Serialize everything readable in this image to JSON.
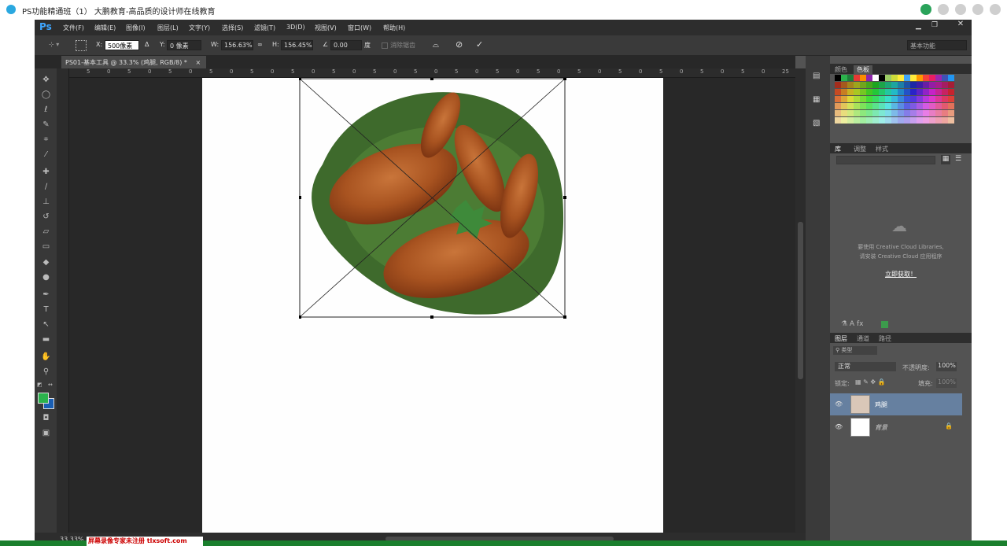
{
  "window": {
    "title": "PS功能精通班（1） 大鹏教育-高品质的设计师在线教育"
  },
  "menu": {
    "items": [
      "文件(F)",
      "编辑(E)",
      "图像(I)",
      "图层(L)",
      "文字(Y)",
      "选择(S)",
      "滤镜(T)",
      "3D(D)",
      "视图(V)",
      "窗口(W)",
      "帮助(H)"
    ]
  },
  "options": {
    "x_label": "X:",
    "x_value": "500像素",
    "y_label": "Y:",
    "y_value": "0 像素",
    "w_label": "W:",
    "w_value": "156.63%",
    "h_label": "H:",
    "h_value": "156.45%",
    "angle_value": "0.00",
    "angle_unit": "度",
    "antialias_label": "消除锯齿",
    "workspace": "基本功能"
  },
  "document": {
    "tab_title": "PS01-基本工具 @ 33.3% (鸡腿, RGB/8) *",
    "zoom": "33.33%"
  },
  "ruler": {
    "top_ticks": [
      "5",
      "0",
      "5",
      "0",
      "5",
      "0",
      "5",
      "0",
      "5",
      "0",
      "5",
      "0",
      "5",
      "0",
      "5",
      "0",
      "5",
      "0",
      "5",
      "0",
      "5",
      "0",
      "5",
      "0",
      "5",
      "0",
      "5",
      "0",
      "5",
      "0",
      "5",
      "0",
      "5",
      "0",
      "25"
    ]
  },
  "panels": {
    "swatch_tabs": [
      "颜色",
      "色板"
    ],
    "library_tabs": [
      "库",
      "调整",
      "样式"
    ],
    "library_msg1": "要使用 Creative Cloud Libraries,",
    "library_msg2": "请安装 Creative Cloud 应用程序",
    "library_link": "立即获取！",
    "layer_tabs": [
      "图层",
      "通道",
      "路径"
    ],
    "filter_kind": "类型",
    "blend_mode": "正常",
    "opacity_label": "不透明度:",
    "opacity_value": "100%",
    "lock_label": "锁定:",
    "fill_label": "填充:",
    "fill_value": "100%",
    "layers": [
      {
        "name": "鸡腿",
        "selected": true
      },
      {
        "name": "背景",
        "selected": false,
        "locked": true
      }
    ]
  },
  "colors": {
    "foreground": "#2bb24c",
    "background": "#1a5fb4",
    "accent": "#3ea6ff"
  },
  "watermark": "屏幕录像专家未注册 tlxsoft.com"
}
